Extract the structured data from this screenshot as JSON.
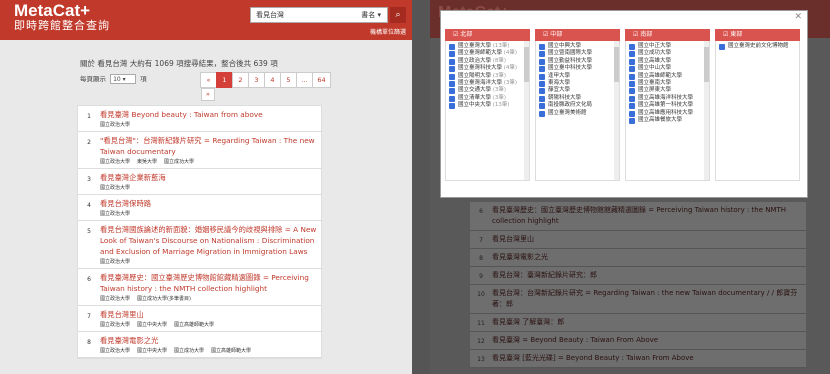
{
  "header": {
    "logo_main": "MetaCat+",
    "logo_sub": "即時跨館整合查詢",
    "search_value": "看見台灣",
    "search_scope": "書名",
    "advanced": "機構單位篩選"
  },
  "summary": "關於 看見台灣 大約有 1069 項搜尋結果，整合後共 639 項",
  "per_page": {
    "prefix": "每頁顯示",
    "value": "10",
    "suffix": "項"
  },
  "pager": {
    "items": [
      "«",
      "1",
      "2",
      "3",
      "4",
      "5",
      "…",
      "64"
    ],
    "next": "»"
  },
  "results": [
    {
      "num": "1",
      "title": "看見臺灣 Beyond beauty : Taiwan from above",
      "libs": [
        "國立政治大學"
      ]
    },
    {
      "num": "2",
      "title": "\"看見台灣\"：台灣新紀錄片研究 = Regarding Taiwan : The new Taiwan documentary",
      "libs": [
        "國立政治大學",
        "東吳大學",
        "國立成功大學"
      ]
    },
    {
      "num": "3",
      "title": "看見臺灣企業新藍海",
      "libs": [
        "國立政治大學"
      ]
    },
    {
      "num": "4",
      "title": "看見台灣保時路",
      "libs": [
        "國立政治大學"
      ]
    },
    {
      "num": "5",
      "title": "看見台灣國族論述的新面貌：婚姻移民議今的歧視與排除 = A New Look of Taiwan's Discourse on Nationalism : Discrimination and Exclusion of Marriage Migration in Immigration Laws",
      "libs": [
        "國立政治大學"
      ]
    },
    {
      "num": "6",
      "title": "看見臺灣歷史：國立臺灣歷史博物館館藏精選圖錄 = Perceiving Taiwan history : the NMTH collection highlight",
      "libs": [
        "國立政治大學",
        "國立成功大學(多筆書目)"
      ]
    },
    {
      "num": "7",
      "title": "看見台灣里山",
      "libs": [
        "國立政治大學",
        "國立中央大學",
        "國立高雄師範大學"
      ]
    },
    {
      "num": "8",
      "title": "看見臺灣電影之光",
      "libs": [
        "國立政治大學",
        "國立中央大學",
        "國立成功大學",
        "國立高雄師範大學"
      ]
    }
  ],
  "right_results": [
    {
      "num": "6",
      "title": "看見臺灣歷史：國立臺灣歷史博物館館藏精選圖錄 = Perceiving Taiwan history : the NMTH collection highlight"
    },
    {
      "num": "7",
      "title": "看見台灣里山"
    },
    {
      "num": "8",
      "title": "看見臺灣電影之光"
    },
    {
      "num": "9",
      "title": "看見台灣：臺灣新紀錄片研究：郎"
    },
    {
      "num": "10",
      "title": "看見台灣：台灣新紀錄片研究 = Regarding Taiwan : the new Taiwan documentary / / 郎寶芬著：郎"
    },
    {
      "num": "11",
      "title": "看見臺灣 了解臺灣：郎"
    },
    {
      "num": "12",
      "title": "看見臺灣 = Beyond Beauty : Taiwan From Above"
    },
    {
      "num": "13",
      "title": "看見臺灣 [藍光光碟] = Beyond Beauty : Taiwan From Above"
    }
  ],
  "regions": [
    {
      "name": "北部",
      "items": [
        {
          "name": "國立臺灣大學",
          "count": "(13筆)"
        },
        {
          "name": "國立臺灣師範大學",
          "count": "(4筆)"
        },
        {
          "name": "國立政治大學",
          "count": "(8筆)"
        },
        {
          "name": "國立臺灣科技大學",
          "count": "(4筆)"
        },
        {
          "name": "國立陽明大學",
          "count": "(3筆)"
        },
        {
          "name": "國立臺灣海洋大學",
          "count": "(3筆)"
        },
        {
          "name": "國立交通大學",
          "count": "(3筆)"
        },
        {
          "name": "國立清華大學",
          "count": "(3筆)"
        },
        {
          "name": "國立中央大學",
          "count": "(13筆)"
        }
      ]
    },
    {
      "name": "中部",
      "items": [
        {
          "name": "國立中興大學",
          "count": ""
        },
        {
          "name": "國立暨南國際大學",
          "count": ""
        },
        {
          "name": "國立勤益科技大學",
          "count": ""
        },
        {
          "name": "國立臺中科技大學",
          "count": ""
        },
        {
          "name": "逢甲大學",
          "count": ""
        },
        {
          "name": "東海大學",
          "count": ""
        },
        {
          "name": "靜宜大學",
          "count": ""
        },
        {
          "name": "朝陽科技大學",
          "count": ""
        },
        {
          "name": "南投縣政府文化局",
          "count": ""
        },
        {
          "name": "國立臺灣美術館",
          "count": ""
        }
      ]
    },
    {
      "name": "南部",
      "items": [
        {
          "name": "國立中正大學",
          "count": ""
        },
        {
          "name": "國立成功大學",
          "count": ""
        },
        {
          "name": "國立高雄大學",
          "count": ""
        },
        {
          "name": "國立中山大學",
          "count": ""
        },
        {
          "name": "國立高雄師範大學",
          "count": ""
        },
        {
          "name": "國立臺南大學",
          "count": ""
        },
        {
          "name": "國立屏東大學",
          "count": ""
        },
        {
          "name": "國立高雄海洋科技大學",
          "count": ""
        },
        {
          "name": "國立高雄第一科技大學",
          "count": ""
        },
        {
          "name": "國立高雄應用科技大學",
          "count": ""
        },
        {
          "name": "國立高雄餐旅大學",
          "count": ""
        }
      ]
    },
    {
      "name": "東部",
      "items": [
        {
          "name": "國立臺灣史前文化博物館",
          "count": ""
        }
      ]
    }
  ],
  "colors": {
    "brand": "#c0392b",
    "accent": "#d9534f",
    "checkbox": "#3a6ed8"
  }
}
